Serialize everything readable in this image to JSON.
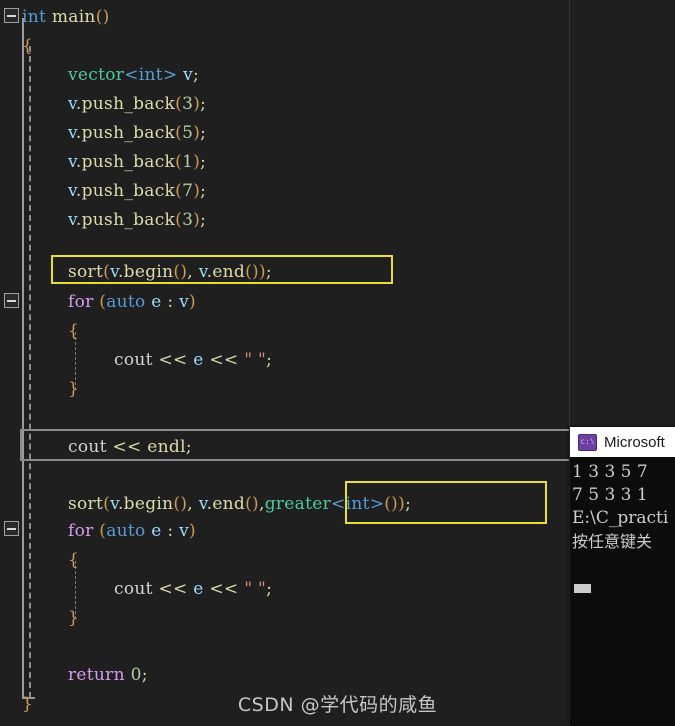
{
  "editor": {
    "language": "cpp",
    "background": "#1f1f1f",
    "lines": [
      {
        "indent": 0,
        "text": "int main()"
      },
      {
        "indent": 1,
        "text": "{"
      },
      {
        "indent": 2,
        "text": "vector<int> v;"
      },
      {
        "indent": 2,
        "text": "v.push_back(3);"
      },
      {
        "indent": 2,
        "text": "v.push_back(5);"
      },
      {
        "indent": 2,
        "text": "v.push_back(1);"
      },
      {
        "indent": 2,
        "text": "v.push_back(7);"
      },
      {
        "indent": 2,
        "text": "v.push_back(3);"
      },
      {
        "indent": 2,
        "text": "sort(v.begin(), v.end());"
      },
      {
        "indent": 2,
        "text": "for (auto e : v)"
      },
      {
        "indent": 2,
        "text": "{"
      },
      {
        "indent": 3,
        "text": "cout << e << \" \";"
      },
      {
        "indent": 2,
        "text": "}"
      },
      {
        "indent": 2,
        "text": "cout << endl;"
      },
      {
        "indent": 2,
        "text": "sort(v.begin(), v.end(),greater<int>());"
      },
      {
        "indent": 2,
        "text": "for (auto e : v)"
      },
      {
        "indent": 2,
        "text": "{"
      },
      {
        "indent": 3,
        "text": "cout << e << \" \";"
      },
      {
        "indent": 2,
        "text": "}"
      },
      {
        "indent": 2,
        "text": "return 0;"
      },
      {
        "indent": 1,
        "text": "}"
      }
    ],
    "highlights": [
      {
        "name": "sort-ascending-highlight",
        "color": "#e8e02a",
        "label": "sort(v.begin(), v.end());"
      },
      {
        "name": "greater-comparator-highlight",
        "color": "#e8e02a",
        "label": "greater<int>()"
      },
      {
        "name": "current-line-highlight",
        "color": "#8a8a8a",
        "label": "cout << endl;"
      }
    ],
    "fold_markers": [
      {
        "name": "fold-main-function",
        "state": "expanded"
      },
      {
        "name": "fold-first-for-loop",
        "state": "expanded"
      },
      {
        "name": "fold-second-for-loop",
        "state": "expanded"
      }
    ],
    "tokens": {
      "int": "int",
      "main": "main",
      "vector": "vector",
      "v": "v",
      "push_back": "push_back",
      "sort": "sort",
      "begin": "begin",
      "end": "end",
      "for": "for",
      "auto": "auto",
      "e": "e",
      "cout": "cout",
      "endl": "endl",
      "greater": "greater",
      "return": "return",
      "zero": "0",
      "space_string": "\" \"",
      "pb_values": [
        "3",
        "5",
        "1",
        "7",
        "3"
      ]
    }
  },
  "console": {
    "title": "Microsoft",
    "icon": "cmd-console-icon",
    "icon_glyph": "c:\\",
    "lines": [
      "1 3 3 5 7",
      "7 5 3 3 1",
      "E:\\C_practi",
      "按任意键关"
    ],
    "cursor_visible": true
  },
  "watermark": {
    "text": "CSDN @学代码的咸鱼"
  }
}
